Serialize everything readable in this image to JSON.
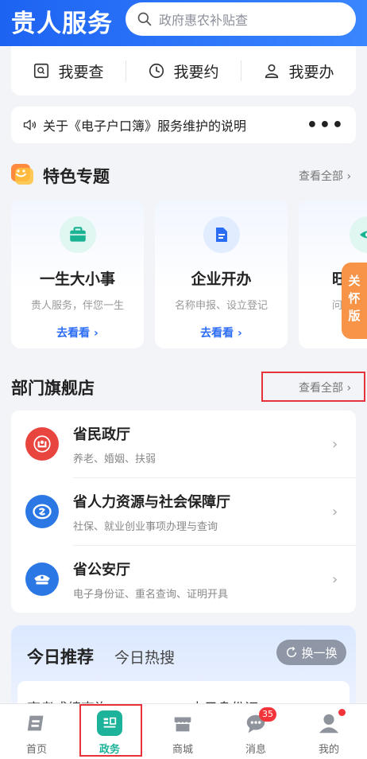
{
  "header": {
    "brand": "贵人服务",
    "search_placeholder": "政府惠农补贴查"
  },
  "quick_actions": [
    {
      "label": "我要查",
      "icon": "search-doc-icon"
    },
    {
      "label": "我要约",
      "icon": "clock-icon"
    },
    {
      "label": "我要办",
      "icon": "user-icon"
    }
  ],
  "notice": {
    "text": "关于《电子户口簿》服务维护的说明",
    "more": "•••"
  },
  "featured": {
    "title": "特色专题",
    "see_all": "查看全部",
    "cards": [
      {
        "name": "一生大小事",
        "desc": "贵人服务，伴您一生",
        "link": "去看看",
        "icon": "briefcase-icon"
      },
      {
        "name": "企业开办",
        "desc": "名称申报、设立登记",
        "link": "去看看",
        "icon": "document-icon"
      },
      {
        "name": "旺",
        "desc": "问",
        "link": "",
        "icon": "eye-icon"
      }
    ]
  },
  "side_tab": {
    "label": "关怀版"
  },
  "departments": {
    "title": "部门旗舰店",
    "see_all": "查看全部",
    "items": [
      {
        "name": "省民政厅",
        "desc": "养老、婚姻、扶弱",
        "icon": "civil-affairs-icon"
      },
      {
        "name": "省人力资源与社会保障厅",
        "desc": "社保、就业创业事项办理与查询",
        "icon": "social-security-icon"
      },
      {
        "name": "省公安厅",
        "desc": "电子身份证、重名查询、证明开具",
        "icon": "police-cap-icon"
      }
    ]
  },
  "recommend": {
    "tab_active": "今日推荐",
    "tab_other": "今日热搜",
    "refresh": "换一换",
    "items": [
      "高考成绩查询",
      "电子身份证"
    ]
  },
  "tabbar": {
    "items": [
      {
        "label": "首页",
        "icon": "home-icon"
      },
      {
        "label": "政务",
        "icon": "government-icon"
      },
      {
        "label": "商城",
        "icon": "shop-icon"
      },
      {
        "label": "消息",
        "icon": "message-icon",
        "badge": "35"
      },
      {
        "label": "我的",
        "icon": "profile-icon"
      }
    ]
  },
  "colors": {
    "primary": "#2b6cf5",
    "accent_green": "#1db39a",
    "badge_red": "#f3343a",
    "side_tab_orange": "#f79447"
  }
}
